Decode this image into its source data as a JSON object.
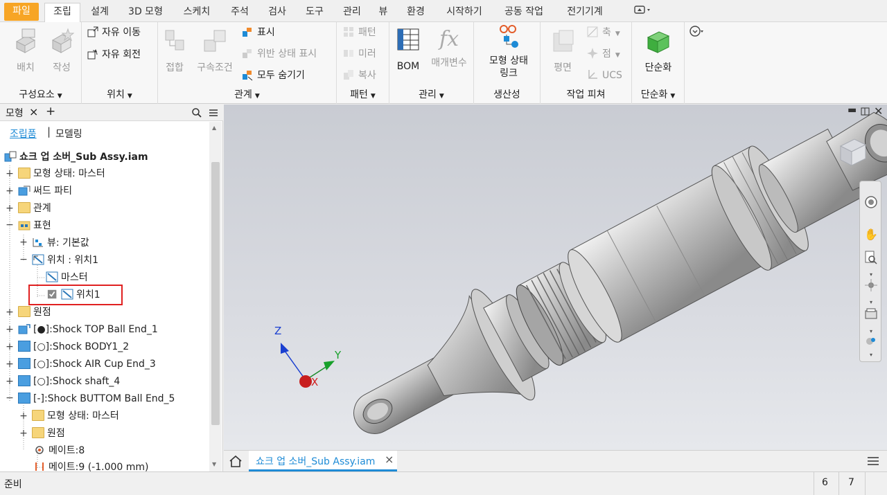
{
  "menu": {
    "tabs": [
      "파일",
      "조립",
      "설계",
      "3D 모형",
      "스케치",
      "주석",
      "검사",
      "도구",
      "관리",
      "뷰",
      "환경",
      "시작하기",
      "공동 작업",
      "전기기계"
    ],
    "active": "조립"
  },
  "ribbon": {
    "component_panel": {
      "title": "구성요소",
      "place": "배치",
      "create": "작성"
    },
    "position_panel": {
      "title": "위치",
      "free_move": "자유 이동",
      "free_rotate": "자유 회전"
    },
    "relation_panel": {
      "title": "관계",
      "join": "접합",
      "constrain": "구속조건",
      "show": "표시",
      "show_sick": "위반 상태 표시",
      "hide_all": "모두 숨기기"
    },
    "pattern_panel": {
      "title": "패턴",
      "pattern": "패턴",
      "mirror": "미러",
      "copy": "복사"
    },
    "manage_panel": {
      "title": "관리",
      "bom": "BOM",
      "params": "매개변수"
    },
    "productivity_panel": {
      "title": "생산성",
      "model_state_link_1": "모형 상태",
      "model_state_link_2": "링크"
    },
    "workfeatures_panel": {
      "title": "작업 피쳐",
      "plane": "평면",
      "axis": "축",
      "point": "점",
      "ucs": "UCS"
    },
    "simplify_panel": {
      "title": "단순화",
      "simplify": "단순화"
    }
  },
  "browser": {
    "tab_label": "모형",
    "close": "×",
    "add": "+",
    "view_assembly": "조립품",
    "view_modeling": "모델링",
    "root": "쇼크 업 소버_Sub Assy.iam",
    "nodes": [
      {
        "label": "모형 상태: 마스터"
      },
      {
        "label": "써드 파티"
      },
      {
        "label": "관계"
      },
      {
        "label": "표현"
      },
      {
        "label": "뷰: 기본값"
      },
      {
        "label": "위치 : 위치1"
      },
      {
        "label": "마스터"
      },
      {
        "label": "위치1"
      },
      {
        "label": "원점"
      },
      {
        "label": "[●]:Shock TOP Ball End_1"
      },
      {
        "label": "[○]:Shock BODY1_2"
      },
      {
        "label": "[○]:Shock AIR Cup End_3"
      },
      {
        "label": "[○]:Shock shaft_4"
      },
      {
        "label": "[-]:Shock BUTTOM Ball End_5"
      },
      {
        "label": "모형 상태: 마스터"
      },
      {
        "label": "원점"
      },
      {
        "label": "메이트:8"
      },
      {
        "label": "메이트:9 (-1.000 mm)"
      }
    ]
  },
  "viewport": {
    "axis_x": "X",
    "axis_y": "Y",
    "axis_z": "Z"
  },
  "doc_tab": {
    "label": "쇼크 업 소버_Sub Assy.iam",
    "close": "×"
  },
  "status": {
    "text": "준비",
    "count_1": "6",
    "count_2": "7"
  },
  "colors": {
    "file_tab": "#f7a525",
    "accent": "#1e8bd6",
    "highlight_box": "#e02020"
  }
}
